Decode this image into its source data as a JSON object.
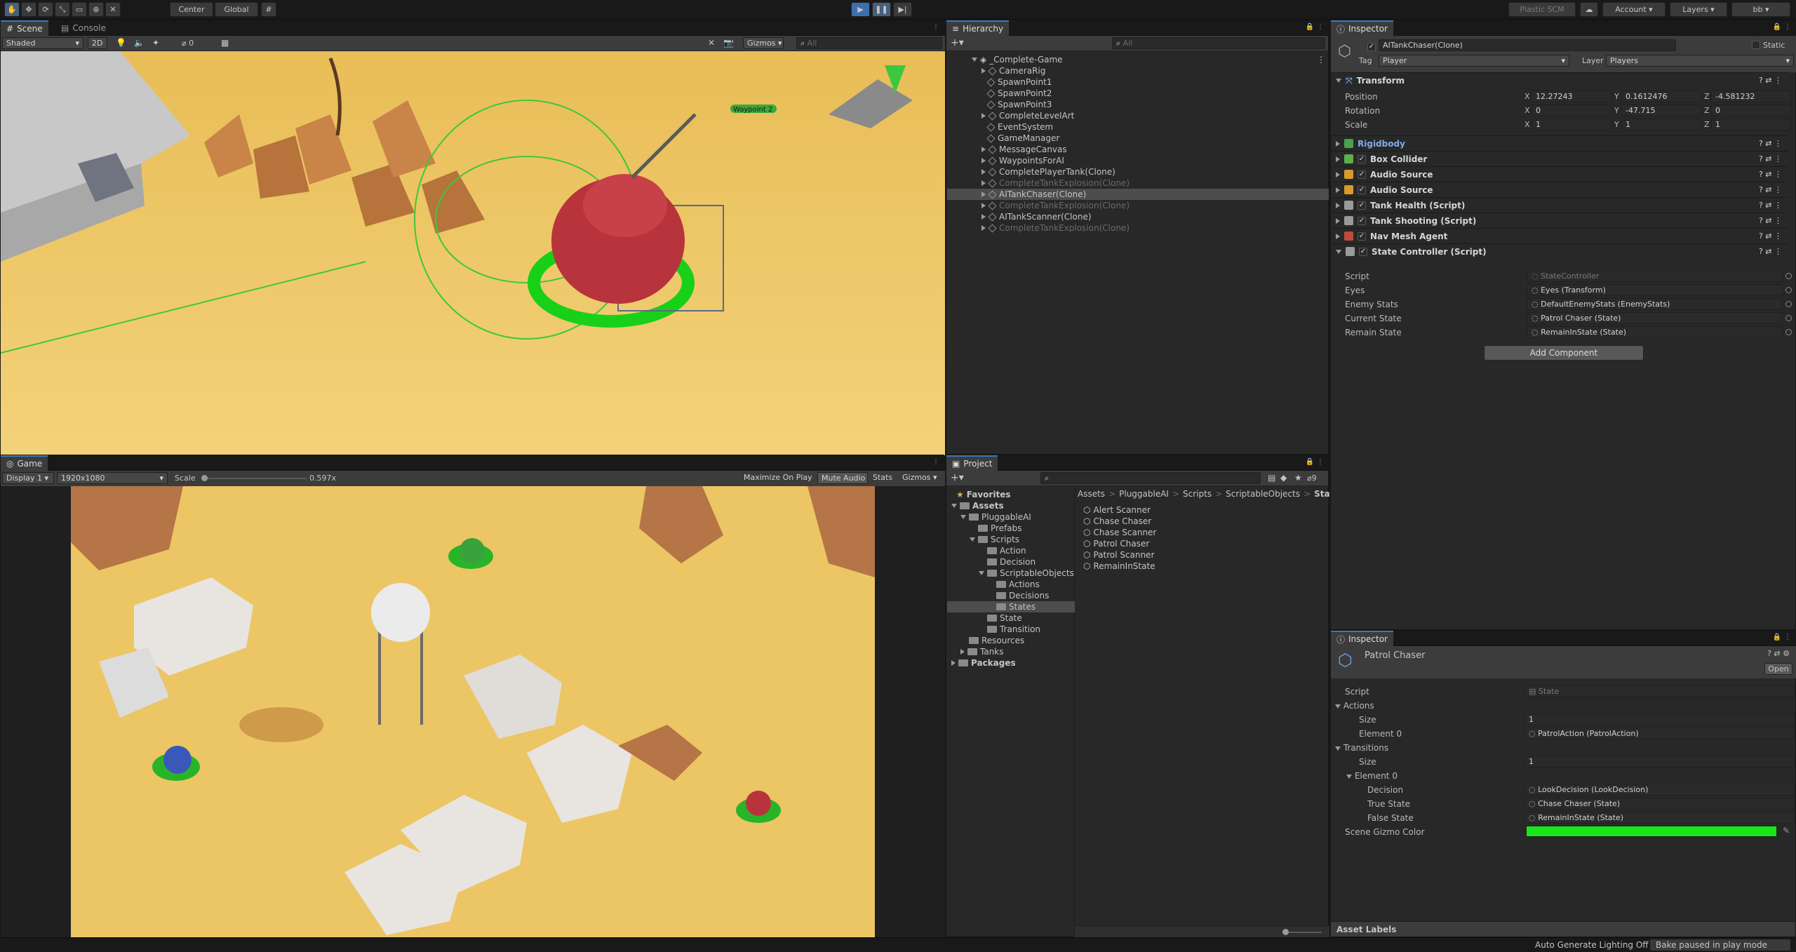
{
  "toolbar": {
    "pivot": "Center",
    "space": "Global",
    "plastic": "Plastic SCM",
    "account": "Account",
    "layers": "Layers",
    "layout": "bb"
  },
  "scene": {
    "tab_scene": "Scene",
    "tab_console": "Console",
    "shading": "Shaded",
    "mode_2d": "2D",
    "hidden_count": "0",
    "gizmos": "Gizmos",
    "search_placeholder": "All",
    "waypoint_label": "Waypoint 2"
  },
  "game": {
    "tab": "Game",
    "display": "Display 1",
    "resolution": "1920x1080",
    "scale_label": "Scale",
    "scale_value": "0.597x",
    "maximize": "Maximize On Play",
    "mute": "Mute Audio",
    "stats": "Stats",
    "gizmos": "Gizmos"
  },
  "hierarchy": {
    "tab": "Hierarchy",
    "search_placeholder": "All",
    "scene_name": "_Complete-Game",
    "items": [
      {
        "label": "CameraRig",
        "dim": false,
        "sel": false,
        "arrow": true
      },
      {
        "label": "SpawnPoint1",
        "dim": false,
        "sel": false,
        "arrow": false
      },
      {
        "label": "SpawnPoint2",
        "dim": false,
        "sel": false,
        "arrow": false
      },
      {
        "label": "SpawnPoint3",
        "dim": false,
        "sel": false,
        "arrow": false
      },
      {
        "label": "CompleteLevelArt",
        "dim": false,
        "sel": false,
        "arrow": true
      },
      {
        "label": "EventSystem",
        "dim": false,
        "sel": false,
        "arrow": false
      },
      {
        "label": "GameManager",
        "dim": false,
        "sel": false,
        "arrow": false
      },
      {
        "label": "MessageCanvas",
        "dim": false,
        "sel": false,
        "arrow": true
      },
      {
        "label": "WaypointsForAI",
        "dim": false,
        "sel": false,
        "arrow": true
      },
      {
        "label": "CompletePlayerTank(Clone)",
        "dim": false,
        "sel": false,
        "arrow": true
      },
      {
        "label": "CompleteTankExplosion(Clone)",
        "dim": true,
        "sel": false,
        "arrow": true
      },
      {
        "label": "AITankChaser(Clone)",
        "dim": false,
        "sel": true,
        "arrow": true
      },
      {
        "label": "CompleteTankExplosion(Clone)",
        "dim": true,
        "sel": false,
        "arrow": true
      },
      {
        "label": "AITankScanner(Clone)",
        "dim": false,
        "sel": false,
        "arrow": true
      },
      {
        "label": "CompleteTankExplosion(Clone)",
        "dim": true,
        "sel": false,
        "arrow": true
      }
    ]
  },
  "project": {
    "tab": "Project",
    "hidden_count": "9",
    "favorites": "Favorites",
    "tree": [
      {
        "label": "Assets",
        "depth": 0,
        "open": true,
        "sel": false,
        "bold": true
      },
      {
        "label": "PluggableAI",
        "depth": 1,
        "open": true,
        "sel": false,
        "bold": false
      },
      {
        "label": "Prefabs",
        "depth": 2,
        "open": false,
        "sel": false,
        "bold": false,
        "noarrow": true
      },
      {
        "label": "Scripts",
        "depth": 2,
        "open": true,
        "sel": false,
        "bold": false
      },
      {
        "label": "Action",
        "depth": 3,
        "open": false,
        "sel": false,
        "bold": false,
        "noarrow": true
      },
      {
        "label": "Decision",
        "depth": 3,
        "open": false,
        "sel": false,
        "bold": false,
        "noarrow": true
      },
      {
        "label": "ScriptableObjects",
        "depth": 3,
        "open": true,
        "sel": false,
        "bold": false
      },
      {
        "label": "Actions",
        "depth": 4,
        "open": false,
        "sel": false,
        "bold": false,
        "noarrow": true
      },
      {
        "label": "Decisions",
        "depth": 4,
        "open": false,
        "sel": false,
        "bold": false,
        "noarrow": true
      },
      {
        "label": "States",
        "depth": 4,
        "open": false,
        "sel": true,
        "bold": false,
        "noarrow": true
      },
      {
        "label": "State",
        "depth": 3,
        "open": false,
        "sel": false,
        "bold": false,
        "noarrow": true
      },
      {
        "label": "Transition",
        "depth": 3,
        "open": false,
        "sel": false,
        "bold": false,
        "noarrow": true
      },
      {
        "label": "Resources",
        "depth": 1,
        "open": false,
        "sel": false,
        "bold": false,
        "noarrow": true
      },
      {
        "label": "Tanks",
        "depth": 1,
        "open": false,
        "sel": false,
        "bold": false
      },
      {
        "label": "Packages",
        "depth": 0,
        "open": false,
        "sel": false,
        "bold": true
      }
    ],
    "breadcrumb": [
      "Assets",
      "PluggableAI",
      "Scripts",
      "ScriptableObjects",
      "States"
    ],
    "files": [
      "Alert Scanner",
      "Chase Chaser",
      "Chase Scanner",
      "Patrol Chaser",
      "Patrol Scanner",
      "RemainInState"
    ]
  },
  "inspector": {
    "tab": "Inspector",
    "object_name": "AITankChaser(Clone)",
    "static_label": "Static",
    "tag_label": "Tag",
    "tag_value": "Player",
    "layer_label": "Layer",
    "layer_value": "Players",
    "transform": {
      "title": "Transform",
      "position_label": "Position",
      "rotation_label": "Rotation",
      "scale_label": "Scale",
      "position": {
        "x": "12.27243",
        "y": "0.1612476",
        "z": "-4.581232"
      },
      "rotation": {
        "x": "0",
        "y": "-47.715",
        "z": "0"
      },
      "scale": {
        "x": "1",
        "y": "1",
        "z": "1"
      }
    },
    "components": [
      {
        "name": "Rigidbody",
        "color": "#4ba24b",
        "check": false,
        "link": true
      },
      {
        "name": "Box Collider",
        "color": "#5ab04a",
        "check": true,
        "link": false
      },
      {
        "name": "Audio Source",
        "color": "#d89a2c",
        "check": true,
        "link": false
      },
      {
        "name": "Audio Source",
        "color": "#d89a2c",
        "check": true,
        "link": false
      },
      {
        "name": "Tank Health (Script)",
        "color": "#9a9a9a",
        "check": true,
        "link": false
      },
      {
        "name": "Tank Shooting (Script)",
        "color": "#9a9a9a",
        "check": true,
        "link": false
      },
      {
        "name": "Nav Mesh Agent",
        "color": "#c04a3a",
        "check": true,
        "link": false
      },
      {
        "name": "State Controller (Script)",
        "color": "#9a9a9a",
        "check": true,
        "link": false
      }
    ],
    "state_controller": [
      {
        "label": "Script",
        "value": "StateController",
        "dim": true
      },
      {
        "label": "Eyes",
        "value": "Eyes (Transform)",
        "dim": false
      },
      {
        "label": "Enemy Stats",
        "value": "DefaultEnemyStats (EnemyStats)",
        "dim": false
      },
      {
        "label": "Current State",
        "value": "Patrol Chaser (State)",
        "dim": false
      },
      {
        "label": "Remain State",
        "value": "RemainInState (State)",
        "dim": false
      }
    ],
    "add_component": "Add Component"
  },
  "inspector2": {
    "tab": "Inspector",
    "title": "Patrol Chaser",
    "open_button": "Open",
    "script_label": "Script",
    "script_value": "State",
    "actions_label": "Actions",
    "size_label": "Size",
    "actions_size": "1",
    "element0_label": "Element 0",
    "action_value": "PatrolAction (PatrolAction)",
    "transitions_label": "Transitions",
    "transitions_size": "1",
    "decision_label": "Decision",
    "decision_value": "LookDecision (LookDecision)",
    "true_label": "True State",
    "true_value": "Chase Chaser (State)",
    "false_label": "False State",
    "false_value": "RemainInState (State)",
    "gizmo_color_label": "Scene Gizmo Color",
    "gizmo_color": "#19e619",
    "asset_labels": "Asset Labels"
  },
  "status": {
    "lighting": "Auto Generate Lighting Off",
    "bake": "Bake paused in play mode"
  }
}
